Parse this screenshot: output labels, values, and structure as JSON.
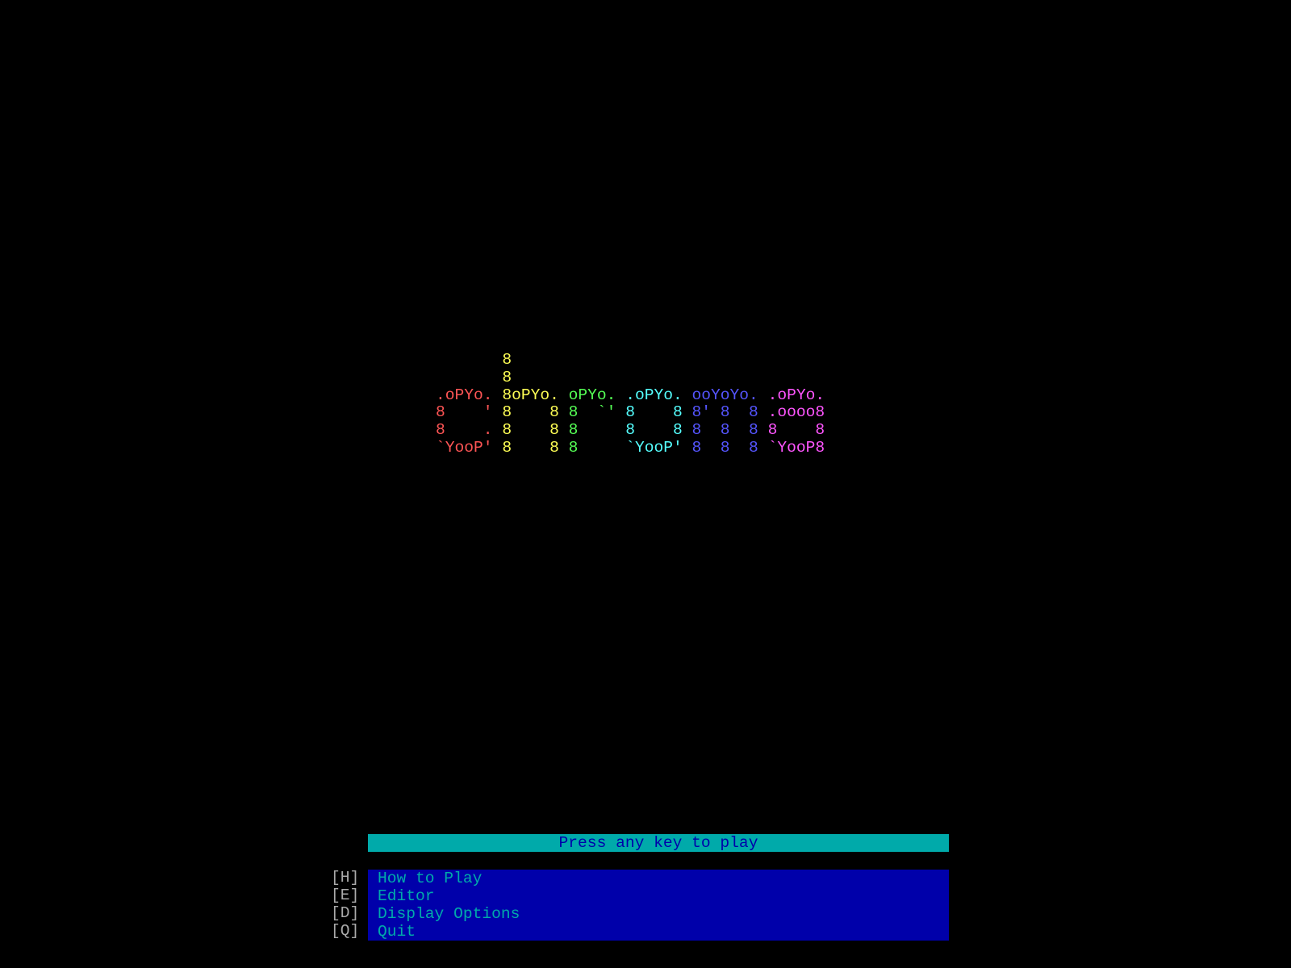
{
  "logo": {
    "lines": [
      [
        {
          "t": "       ",
          "c": ""
        },
        {
          "t": "8",
          "c": "c2"
        }
      ],
      [
        {
          "t": "       ",
          "c": ""
        },
        {
          "t": "8",
          "c": "c2"
        }
      ],
      [
        {
          "t": ".oPYo. ",
          "c": "c1"
        },
        {
          "t": "8oPYo. ",
          "c": "c2"
        },
        {
          "t": "oPYo. ",
          "c": "c3"
        },
        {
          "t": ".oPYo. ",
          "c": "c4"
        },
        {
          "t": "ooYoYo. ",
          "c": "c5"
        },
        {
          "t": ".oPYo.",
          "c": "c6"
        }
      ],
      [
        {
          "t": "8    ' ",
          "c": "c1"
        },
        {
          "t": "8    8 ",
          "c": "c2"
        },
        {
          "t": "8  `' ",
          "c": "c3"
        },
        {
          "t": "8    8 ",
          "c": "c4"
        },
        {
          "t": "8' 8  8 ",
          "c": "c5"
        },
        {
          "t": ".oooo8",
          "c": "c6"
        }
      ],
      [
        {
          "t": "8    . ",
          "c": "c1"
        },
        {
          "t": "8    8 ",
          "c": "c2"
        },
        {
          "t": "8     ",
          "c": "c3"
        },
        {
          "t": "8    8 ",
          "c": "c4"
        },
        {
          "t": "8  8  8 ",
          "c": "c5"
        },
        {
          "t": "8    8",
          "c": "c6"
        }
      ],
      [
        {
          "t": "`YooP' ",
          "c": "c1"
        },
        {
          "t": "8    8 ",
          "c": "c2"
        },
        {
          "t": "8     ",
          "c": "c3"
        },
        {
          "t": "`YooP' ",
          "c": "c4"
        },
        {
          "t": "8  8  8 ",
          "c": "c5"
        },
        {
          "t": "`YooP8",
          "c": "c6"
        }
      ]
    ]
  },
  "prompt": {
    "label": "Press any key to play"
  },
  "menu": {
    "items": [
      {
        "key": "[H]",
        "label": "How to Play"
      },
      {
        "key": "[E]",
        "label": "Editor"
      },
      {
        "key": "[D]",
        "label": "Display Options"
      },
      {
        "key": "[Q]",
        "label": "Quit"
      }
    ]
  },
  "colors": {
    "background": "#000000",
    "prompt_bg": "#00aaaa",
    "prompt_fg": "#0000aa",
    "menu_bg": "#0000aa",
    "menu_fg": "#00aaaa",
    "key_fg": "#aaaaaa",
    "logo_red": "#ff5555",
    "logo_yellow": "#ffff55",
    "logo_green": "#55ff55",
    "logo_cyan": "#55ffff",
    "logo_blue": "#5555ff",
    "logo_magenta": "#ff55ff"
  }
}
